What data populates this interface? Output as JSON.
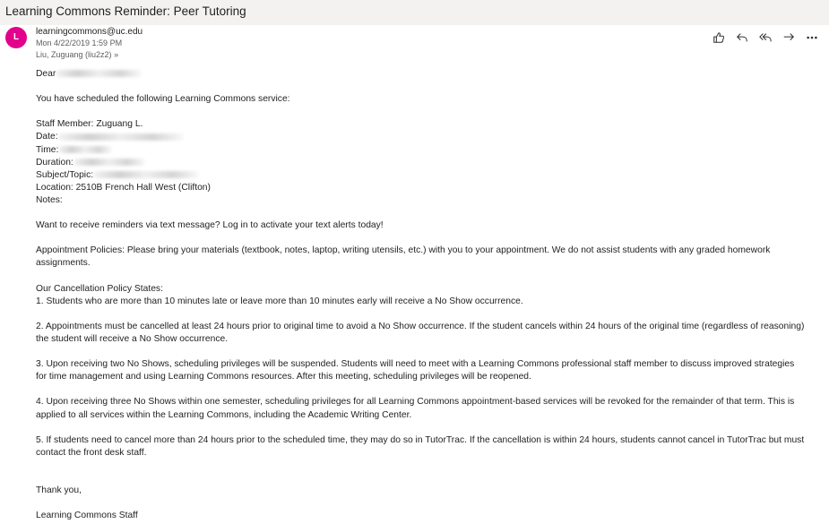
{
  "email": {
    "subject": "Learning Commons Reminder: Peer Tutoring",
    "avatar_letter": "L",
    "from": "learningcommons@uc.edu",
    "date": "Mon 4/22/2019 1:59 PM",
    "to": "Liu, Zuguang (liu2z2)",
    "to_chevron": "»"
  },
  "icons": {
    "like": "thumbs-up-icon",
    "reply": "reply-icon",
    "reply_all": "reply-all-icon",
    "forward": "forward-icon",
    "more": "more-icon"
  },
  "body": {
    "greeting": "Dear",
    "intro": "You have scheduled the following Learning Commons service:",
    "staff": "Staff Member: Zuguang L.",
    "date_label": "Date:",
    "time_label": "Time:",
    "duration_label": "Duration:",
    "subject_label": "Subject/Topic:",
    "location": "Location: 2510B French Hall West (Clifton)",
    "notes_label": "Notes:",
    "sms": "Want to receive reminders via text message? Log in to activate your text alerts today!",
    "policies": "Appointment Policies: Please bring your materials (textbook, notes, laptop, writing utensils, etc.) with you to your appointment. We do not assist students with any graded homework assignments.",
    "cancel_header": "Our Cancellation Policy States:",
    "p1": "1. Students who are more than 10 minutes late or leave more than 10 minutes early will receive a No Show occurrence.",
    "p2": "2. Appointments must be cancelled at least 24 hours prior to original time to avoid a No Show occurrence. If the student cancels within 24 hours of the original time (regardless of reasoning) the student will receive a No Show occurrence.",
    "p3": "3. Upon receiving two No Shows, scheduling privileges will be suspended. Students will need to meet with a Learning Commons professional staff member to discuss improved strategies for time management and using Learning Commons resources. After this meeting, scheduling privileges will be reopened.",
    "p4": "4. Upon receiving three No Shows within one semester, scheduling privileges for all Learning Commons appointment-based services will be revoked for the remainder of that term. This is applied to all services within the Learning Commons, including the Academic Writing Center.",
    "p5": "5. If students need to cancel more than 24 hours prior to the scheduled time, they may do so in TutorTrac. If the cancellation is within 24 hours, students cannot cancel in TutorTrac but must contact the front desk staff.",
    "thanks": "Thank you,",
    "signature": "Learning Commons Staff"
  }
}
